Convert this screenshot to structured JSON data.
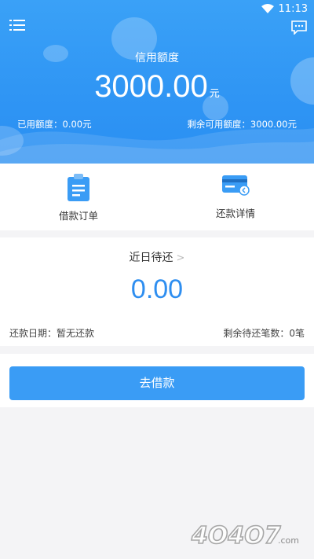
{
  "status_bar": {
    "time": "11:13"
  },
  "header": {
    "credit_title": "信用额度",
    "credit_amount": "3000.00",
    "credit_unit": "元",
    "used": "已用额度：0.00元",
    "remaining": "剩余可用额度：3000.00元"
  },
  "actions": [
    {
      "label": "借款订单",
      "icon": "clipboard-icon"
    },
    {
      "label": "还款详情",
      "icon": "card-icon"
    }
  ],
  "due": {
    "title": "近日待还",
    "chevron": ">",
    "amount": "0.00",
    "date": "还款日期：暂无还款",
    "count": "剩余待还笔数：0笔"
  },
  "borrow_button": "去借款",
  "watermark": "4O4O7.com",
  "colors": {
    "primary": "#2f95f4",
    "button": "#3a9cf5",
    "amount": "#2e8ef0"
  }
}
